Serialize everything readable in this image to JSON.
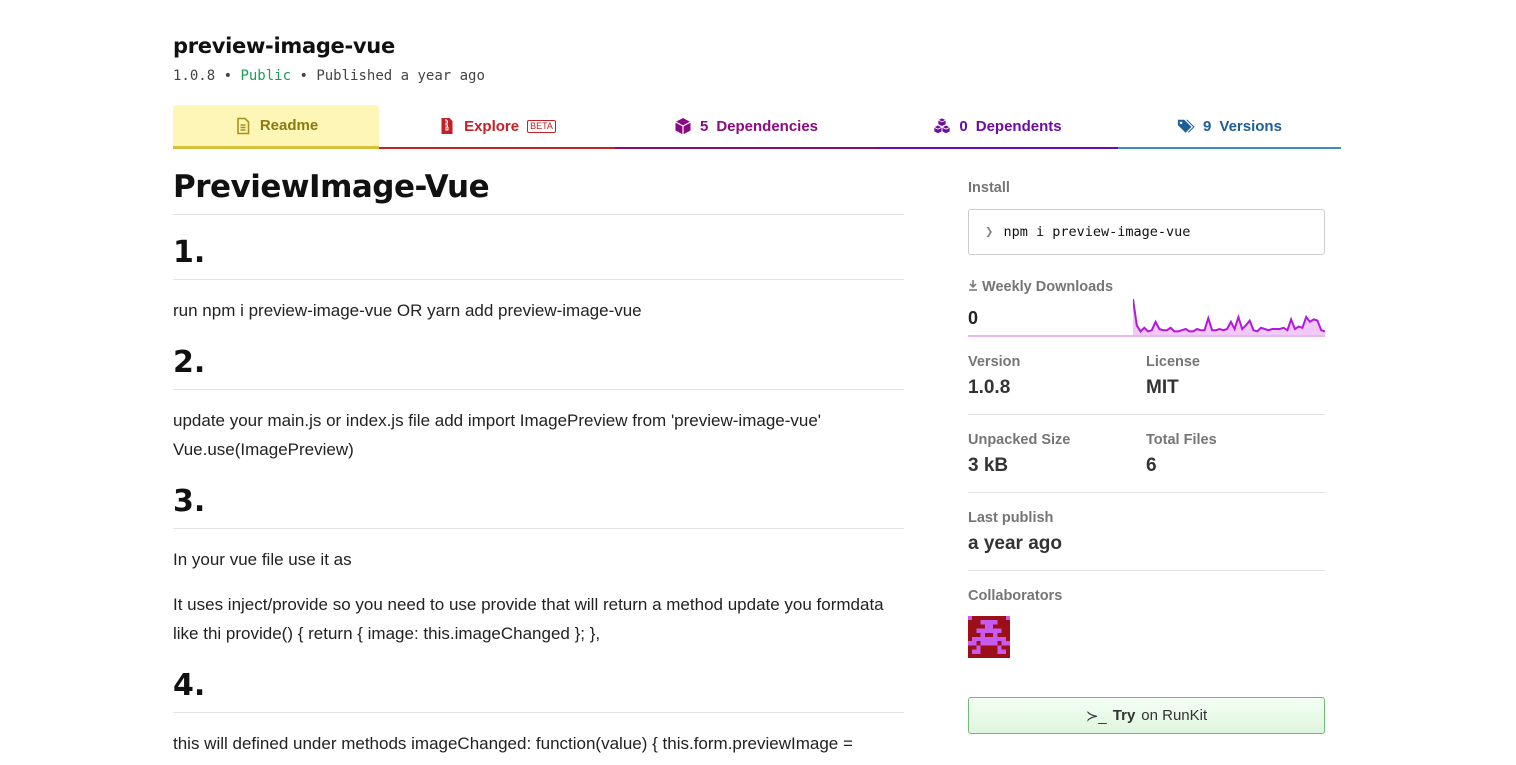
{
  "package": {
    "name": "preview-image-vue",
    "version": "1.0.8",
    "sep1": " • ",
    "visibility": "Public",
    "sep2": " • ",
    "published": "Published a year ago"
  },
  "tabs": {
    "readme": "Readme",
    "explore": "Explore",
    "explore_badge": "BETA",
    "dependencies_count": "5",
    "dependencies_label": "Dependencies",
    "dependents_count": "0",
    "dependents_label": "Dependents",
    "versions_count": "9",
    "versions_label": "Versions"
  },
  "readme": {
    "title": "PreviewImage-Vue",
    "s1_heading": "1.",
    "s1_text": "run npm i preview-image-vue OR yarn add preview-image-vue",
    "s2_heading": "2.",
    "s2_text_line1": "update your main.js or index.js file add import ImagePreview from 'preview-image-vue'",
    "s2_text_line2": "Vue.use(ImagePreview)",
    "s3_heading": "3.",
    "s3_text1": "In your vue file use it as",
    "s3_text2": "It uses inject/provide so you need to use provide that will return a method update you formdata like thi provide() { return { image: this.imageChanged }; },",
    "s4_heading": "4.",
    "s4_text": "this will defined under methods imageChanged: function(value) { this.form.previewImage ="
  },
  "sidebar": {
    "install_label": "Install",
    "install_command": "npm i preview-image-vue",
    "install_prompt": "❯",
    "downloads_label": "Weekly Downloads",
    "downloads_count": "0",
    "version_label": "Version",
    "version_value": "1.0.8",
    "license_label": "License",
    "license_value": "MIT",
    "unpacked_label": "Unpacked Size",
    "unpacked_value": "3 kB",
    "total_files_label": "Total Files",
    "total_files_value": "6",
    "last_publish_label": "Last publish",
    "last_publish_value": "a year ago",
    "collaborators_label": "Collaborators",
    "runkit_prompt": "≻_",
    "runkit_try": "Try",
    "runkit_on": "on RunKit"
  },
  "chart_data": {
    "type": "area",
    "values": [
      30,
      8,
      3,
      6,
      3,
      4,
      11,
      5,
      4,
      4,
      6,
      3,
      3,
      4,
      5,
      3,
      3,
      5,
      4,
      4,
      14,
      4,
      4,
      5,
      4,
      5,
      11,
      5,
      15,
      5,
      8,
      12,
      4,
      3,
      6,
      5,
      4,
      5,
      5,
      5,
      6,
      4,
      13,
      5,
      7,
      6,
      15,
      11,
      13,
      12,
      4,
      3
    ],
    "color": "#b219e0"
  },
  "colors": {
    "readme": "#8b7a11",
    "explore": "#c12127",
    "dependencies": "#8a0a80",
    "dependents": "#6b0ca3",
    "versions": "#1e5e96"
  }
}
